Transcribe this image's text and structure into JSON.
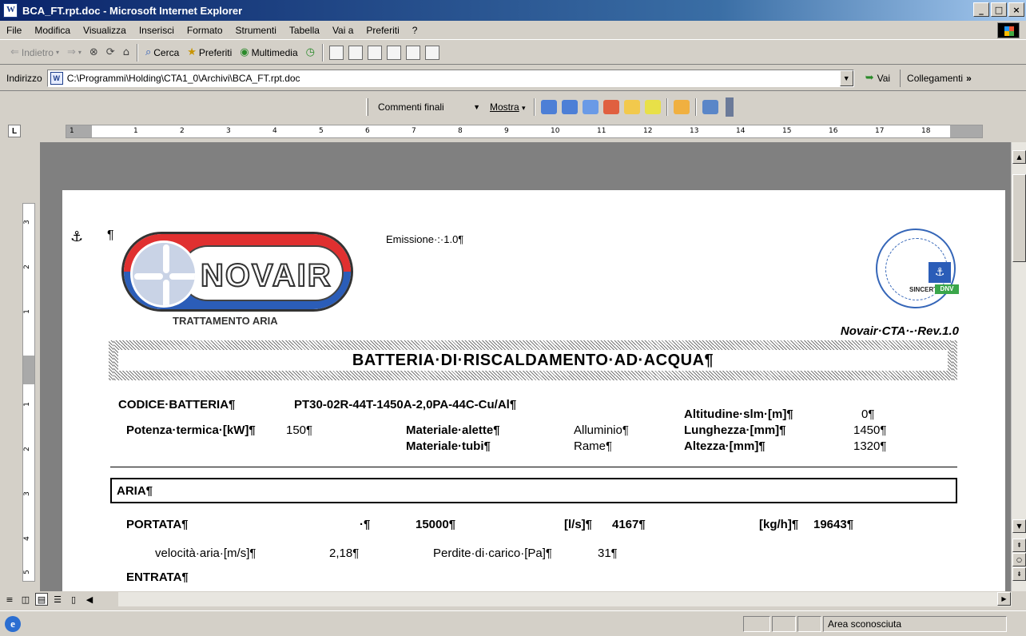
{
  "window": {
    "title": "BCA_FT.rpt.doc - Microsoft Internet Explorer",
    "buttons": {
      "minimize": "_",
      "maximize": "□",
      "close": "×"
    }
  },
  "menu": [
    "File",
    "Modifica",
    "Visualizza",
    "Inserisci",
    "Formato",
    "Strumenti",
    "Tabella",
    "Vai a",
    "Preferiti",
    "?"
  ],
  "toolbar": {
    "back_label": "Indietro",
    "search_label": "Cerca",
    "favorites_label": "Preferiti",
    "multimedia_label": "Multimedia"
  },
  "address": {
    "label": "Indirizzo",
    "value": "C:\\Programmi\\Holding\\CTA1_0\\Archivi\\BCA_FT.rpt.doc",
    "go_label": "Vai",
    "links_label": "Collegamenti"
  },
  "reviewing": {
    "view_combo": "Commenti finali",
    "show_label": "Mostra"
  },
  "ruler": {
    "tab_selector": "L",
    "numbers": [
      "1",
      "1",
      "2",
      "3",
      "4",
      "5",
      "6",
      "7",
      "8",
      "9",
      "10",
      "11",
      "12",
      "13",
      "14",
      "15",
      "16",
      "17",
      "18"
    ],
    "vertical_numbers": [
      "3",
      "2",
      "1",
      "1",
      "2",
      "3",
      "4",
      "5"
    ]
  },
  "document": {
    "anchor": "⚓",
    "para_mark": "¶",
    "logo": {
      "name": "NOVAIR",
      "tagline": "TRATTAMENTO ARIA"
    },
    "emissione": "Emissione·:·1.0¶",
    "cert": {
      "sincert": "SINCERT",
      "dnv": "DNV"
    },
    "revision": "Novair·CTA·-·Rev.1.0",
    "section_title": "BATTERIA·DI·RISCALDAMENTO·AD·ACQUA¶",
    "fields": {
      "codice_label": "CODICE·BATTERIA¶",
      "codice_value": "PT30-02R-44T-1450A-2,0PA-44C-Cu/Al¶",
      "altitudine_label": "Altitudine·slm·[m]¶",
      "altitudine_value": "0¶",
      "potenza_label": "Potenza·termica·[kW]¶",
      "potenza_value": "150¶",
      "mat_alette_label": "Materiale·alette¶",
      "mat_alette_value": "Alluminio¶",
      "lunghezza_label": "Lunghezza·[mm]¶",
      "lunghezza_value": "1450¶",
      "mat_tubi_label": "Materiale·tubi¶",
      "mat_tubi_value": "Rame¶",
      "altezza_label": "Altezza·[mm]¶",
      "altezza_value": "1320¶"
    },
    "aria": "ARIA¶",
    "portata": {
      "label": "PORTATA¶",
      "dot": "·¶",
      "value": "15000¶",
      "ls_label": "[l/s]¶",
      "ls_value": "4167¶",
      "kgh_label": "[kg/h]¶",
      "kgh_value": "19643¶"
    },
    "velocita": {
      "label": "velocità·aria·[m/s]¶",
      "value": "2,18¶"
    },
    "perdite": {
      "label": "Perdite·di·carico·[Pa]¶",
      "value": "31¶"
    },
    "entrata": "ENTRATA¶"
  },
  "status": {
    "zone": "Area sconosciuta"
  }
}
